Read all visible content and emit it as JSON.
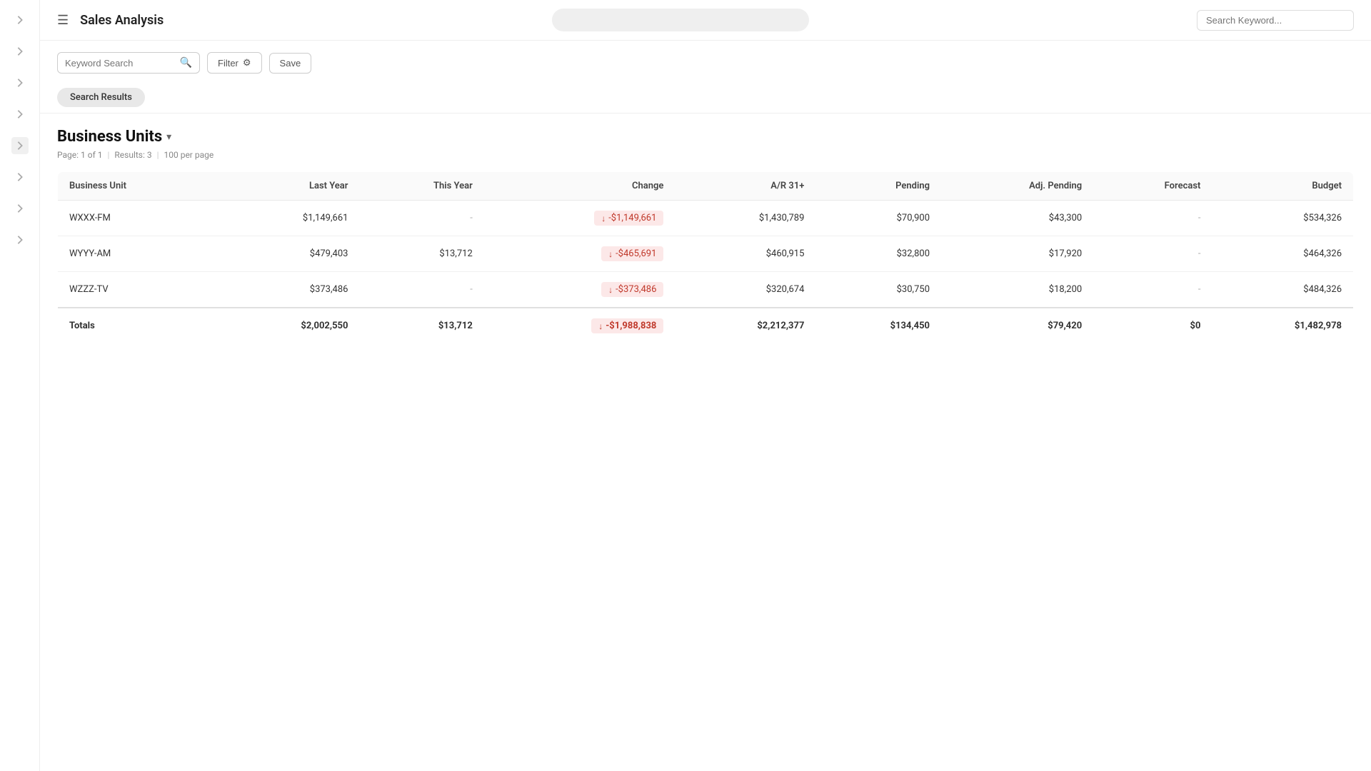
{
  "header": {
    "menu_label": "☰",
    "title": "Sales Analysis",
    "search_placeholder": "Search Keyword..."
  },
  "toolbar": {
    "keyword_search_placeholder": "Keyword Search",
    "filter_label": "Filter",
    "save_label": "Save"
  },
  "tabs": {
    "active_tab": "Search Results"
  },
  "section": {
    "title": "Business Units",
    "pagination": "Page: 1 of 1",
    "results": "Results: 3",
    "per_page": "100 per page"
  },
  "table": {
    "columns": [
      "Business Unit",
      "Last Year",
      "This Year",
      "Change",
      "A/R 31+",
      "Pending",
      "Adj. Pending",
      "Forecast",
      "Budget"
    ],
    "rows": [
      {
        "business_unit": "WXXX-FM",
        "last_year": "$1,149,661",
        "this_year": "-",
        "change": "-$1,149,661",
        "ar31": "$1,430,789",
        "pending": "$70,900",
        "adj_pending": "$43,300",
        "forecast": "-",
        "budget": "$534,326"
      },
      {
        "business_unit": "WYYY-AM",
        "last_year": "$479,403",
        "this_year": "$13,712",
        "change": "-$465,691",
        "ar31": "$460,915",
        "pending": "$32,800",
        "adj_pending": "$17,920",
        "forecast": "-",
        "budget": "$464,326"
      },
      {
        "business_unit": "WZZZ-TV",
        "last_year": "$373,486",
        "this_year": "-",
        "change": "-$373,486",
        "ar31": "$320,674",
        "pending": "$30,750",
        "adj_pending": "$18,200",
        "forecast": "-",
        "budget": "$484,326"
      }
    ],
    "totals": {
      "label": "Totals",
      "last_year": "$2,002,550",
      "this_year": "$13,712",
      "change": "-$1,988,838",
      "ar31": "$2,212,377",
      "pending": "$134,450",
      "adj_pending": "$79,420",
      "forecast": "$0",
      "budget": "$1,482,978"
    }
  },
  "sidebar": {
    "chevrons": [
      "›",
      "›",
      "›",
      "›",
      "›",
      "›",
      "›",
      "›"
    ]
  }
}
